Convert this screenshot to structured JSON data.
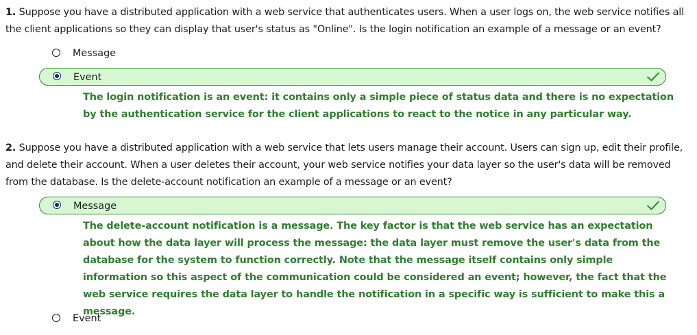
{
  "questions": [
    {
      "number": "1.",
      "text": "Suppose you have a distributed application with a web service that authenticates users. When a user logs on, the web service notifies all the client applications so they can display that user's status as \"Online\". Is the login notification an example of a message or an event?",
      "options": [
        {
          "label": "Message",
          "selected": false,
          "correct": false
        },
        {
          "label": "Event",
          "selected": true,
          "correct": true
        }
      ],
      "explanation": "The login notification is an event: it contains only a simple piece of status data and there is no expectation by the authentication service for the client applications to react to the notice in any particular way."
    },
    {
      "number": "2.",
      "text": "Suppose you have a distributed application with a web service that lets users manage their account. Users can sign up, edit their profile, and delete their account. When a user deletes their account, your web service notifies your data layer so the user's data will be removed from the database. Is the delete-account notification an example of a message or an event?",
      "options": [
        {
          "label": "Message",
          "selected": true,
          "correct": true
        },
        {
          "label": "Event",
          "selected": false,
          "correct": false
        }
      ],
      "explanation": "The delete-account notification is a message. The key factor is that the web service has an expectation about how the data layer will process the message: the data layer must remove the user's data from the database for the system to function correctly. Note that the message itself contains only simple information so this aspect of the communication could be considered an event; however, the fact that the web service requires the data layer to handle the notification in a specific way is sufficient to make this a message."
    }
  ],
  "colors": {
    "selected_bg": "#d7f7d3",
    "selected_border": "#2f8d2f",
    "explanation_text": "#2f7d2f",
    "radio_dot": "#0f2f6b"
  },
  "icons": {
    "correct": "checkmark-icon"
  }
}
